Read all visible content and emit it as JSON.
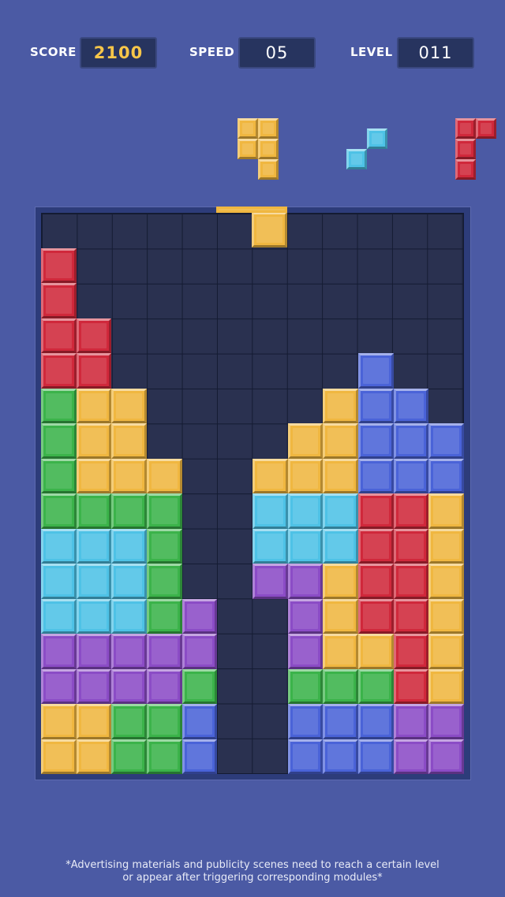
{
  "hud": {
    "score_label": "SCORE",
    "score_value": "2100",
    "speed_label": "SPEED",
    "speed_value": "05",
    "level_label": "LEVEL",
    "level_value": "011"
  },
  "colors": {
    "R": "#d0283b",
    "Y": "#f0b740",
    "G": "#3bb34a",
    "C": "#4ec2e6",
    "B": "#4a63d8",
    "P": "#8b4cc6",
    "background": "#4b5aa4",
    "grid": "#2a3150",
    "score_accent": "#f7c649"
  },
  "next_pieces": [
    {
      "name": "yellow-j-piece",
      "color": "Y",
      "cells": [
        [
          0,
          0
        ],
        [
          1,
          0
        ],
        [
          0,
          1
        ],
        [
          1,
          1
        ],
        [
          1,
          2
        ]
      ]
    },
    {
      "name": "cyan-s-piece",
      "color": "C",
      "cells": [
        [
          1,
          0
        ],
        [
          0,
          1
        ]
      ]
    },
    {
      "name": "red-j-piece",
      "color": "R",
      "cells": [
        [
          0,
          0
        ],
        [
          1,
          0
        ],
        [
          0,
          1
        ],
        [
          0,
          2
        ]
      ]
    }
  ],
  "falling_piece": {
    "color": "Y",
    "cells": [
      [
        6,
        0
      ]
    ]
  },
  "board": {
    "columns": 12,
    "rows": 16,
    "cells": [
      "............",
      "R...........",
      "R...........",
      "RR..........",
      "RR.......B..",
      "GYY.....YBB.",
      "GYY....YYBBB",
      "GYYY..YYYBBB",
      "GGGG..CCCRRY",
      "CCCG..CCCRRY",
      "CCCG..PPYRRY",
      "CCCGP..PYRRY",
      "PPPPP..PYYRY",
      "PPPPG..GGGRY",
      "YYGGB..BBBPP",
      "YYGGB..BBBPP"
    ]
  },
  "disclaimer": {
    "line1": "*Advertising materials and publicity scenes need to reach a certain level",
    "line2": "or appear after triggering corresponding modules*"
  }
}
